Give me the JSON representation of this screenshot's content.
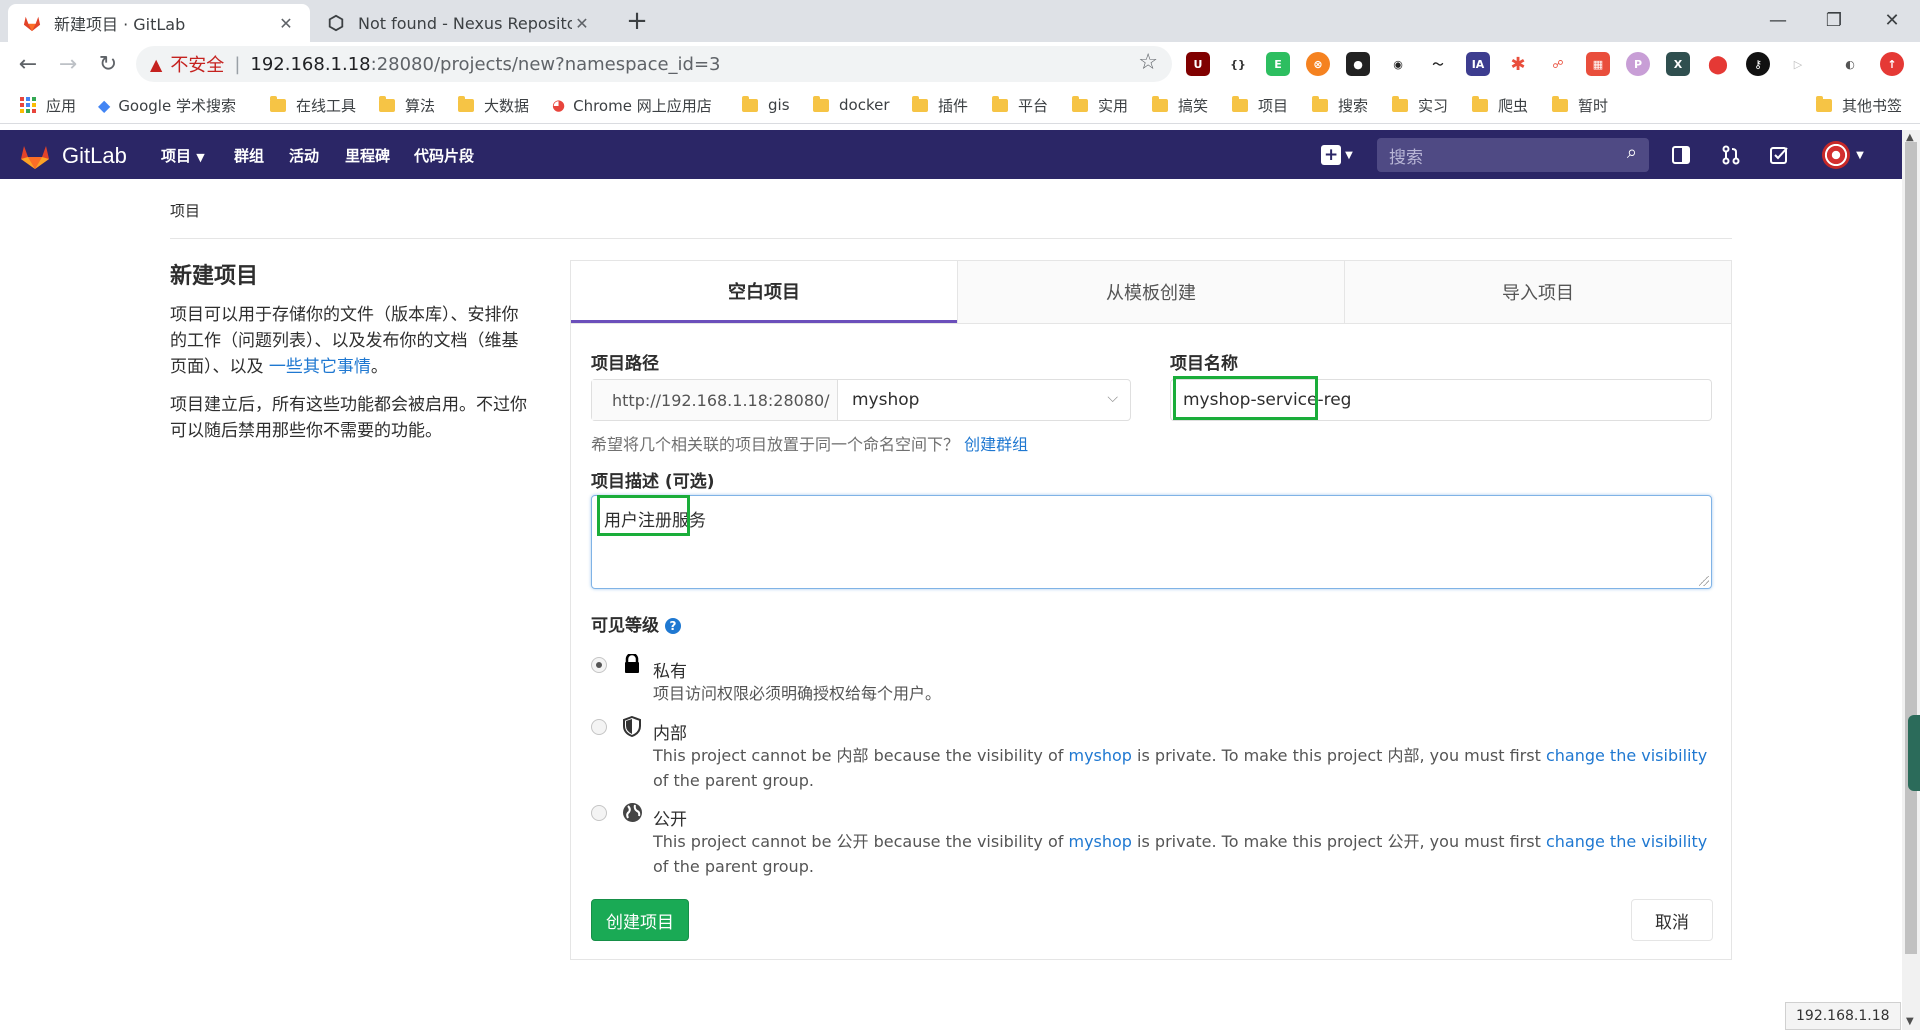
{
  "browser": {
    "tabs": [
      {
        "title": "新建项目 · GitLab",
        "active": true
      },
      {
        "title": "Not found - Nexus Repository",
        "active": false
      }
    ],
    "new_tab": "+",
    "insecure_label": "不安全",
    "url_host": "192.168.1.18",
    "url_path": ":28080/projects/new?namespace_id=3",
    "bookmarks": [
      "应用",
      "Google 学术搜索",
      "在线工具",
      "算法",
      "大数据",
      "Chrome 网上应用店",
      "gis",
      "docker",
      "插件",
      "平台",
      "实用",
      "搞笑",
      "项目",
      "搜索",
      "实习",
      "爬虫",
      "暂时",
      "其他书签"
    ]
  },
  "gitlab": {
    "brand": "GitLab",
    "nav": [
      "项目",
      "群组",
      "活动",
      "里程碑",
      "代码片段"
    ],
    "search_placeholder": "搜索"
  },
  "breadcrumb": "项目",
  "left": {
    "title": "新建项目",
    "p1_text": "项目可以用于存储你的文件（版本库）、安排你的工作（问题列表）、以及发布你的文档（维基页面）、以及 ",
    "p1_link": "一些其它事情",
    "p1_end": "。",
    "p2": "项目建立后，所有这些功能都会被启用。不过你可以随后禁用那些你不需要的功能。"
  },
  "tabs": [
    "空白项目",
    "从模板创建",
    "导入项目"
  ],
  "form": {
    "path_label": "项目路径",
    "path_prefix": "http://192.168.1.18:28080/",
    "namespace": "myshop",
    "name_label": "项目名称",
    "name_value": "myshop-service-reg",
    "group_help": "希望将几个相关联的项目放置于同一个命名空间下？",
    "group_link": "创建群组",
    "desc_label": "项目描述 (可选)",
    "desc_value": "用户注册服务",
    "visibility_label": "可见等级",
    "visibility": [
      {
        "title": "私有",
        "desc": "项目访问权限必须明确授权给每个用户。",
        "checked": true
      },
      {
        "title": "内部",
        "d1": "This project cannot be 内部 because the visibility of ",
        "l1": "myshop",
        "d2": " is private. To make this project 内部, you must first ",
        "l2": "change the visibility",
        "d3": " of the parent group."
      },
      {
        "title": "公开",
        "d1": "This project cannot be 公开 because the visibility of ",
        "l1": "myshop",
        "d2": " is private. To make this project 公开, you must first ",
        "l2": "change the visibility",
        "d3": " of the parent group."
      }
    ],
    "create_button": "创建项目",
    "cancel_button": "取消"
  },
  "status_url": "192.168.1.18",
  "colors": {
    "header": "#2b2666",
    "create": "#1aaa55",
    "highlight": "#1aad3a",
    "link": "#1f78d1"
  }
}
